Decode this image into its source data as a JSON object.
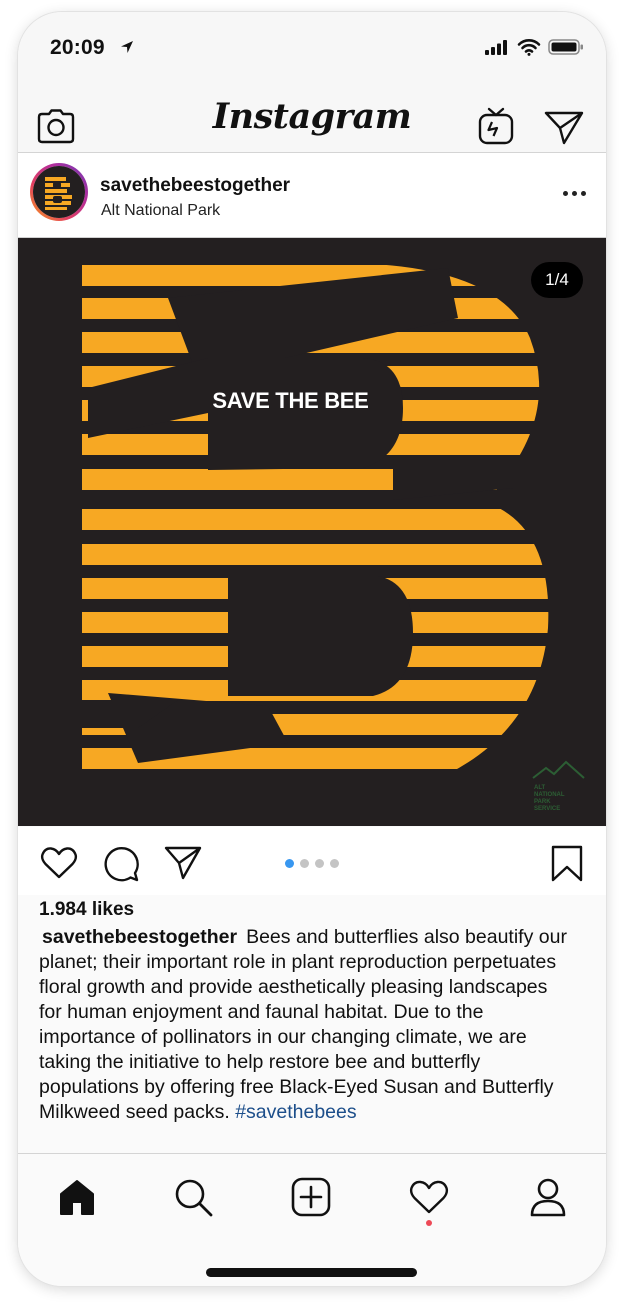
{
  "status_bar": {
    "time": "20:09",
    "icons": [
      "location-arrow-icon",
      "cellular-signal-icon",
      "wifi-icon",
      "battery-icon"
    ]
  },
  "header": {
    "logo_text": "Instagram",
    "left_icon": "camera-icon",
    "right_icons": [
      "igtv-icon",
      "direct-message-icon"
    ]
  },
  "post": {
    "username": "savethebeestogether",
    "location": "Alt National Park",
    "more_icon": "ellipsis-icon",
    "image": {
      "counter": "1/4",
      "overlay_text": "SAVE THE BEE",
      "background_color": "#231f20",
      "accent_color": "#f7a823",
      "watermark_lines": [
        "ALT",
        "NATIONAL",
        "PARK",
        "SERVICE"
      ]
    },
    "actions": [
      "heart-icon",
      "comment-icon",
      "share-icon",
      "bookmark-icon"
    ],
    "carousel": {
      "total": 4,
      "active": 1
    },
    "likes": "1.984 likes",
    "caption": {
      "username": "savethebeestogether",
      "text": "Bees and butterflies also beautify our planet; their important role in plant reproduction perpetuates floral growth and provide aesthetically pleasing landscapes for human enjoyment and faunal habitat. Due to the importance of pollinators in our changing climate, we are taking the initiative to help restore bee and butterfly populations by offering free Black-Eyed Susan and Butterfly Milkweed seed packs.",
      "hashtag": "#savethebees"
    }
  },
  "bottom_nav": {
    "items": [
      "home-icon",
      "search-icon",
      "new-post-icon",
      "activity-icon",
      "profile-icon"
    ],
    "active": "home-icon",
    "notification_color": "#ed4956"
  }
}
